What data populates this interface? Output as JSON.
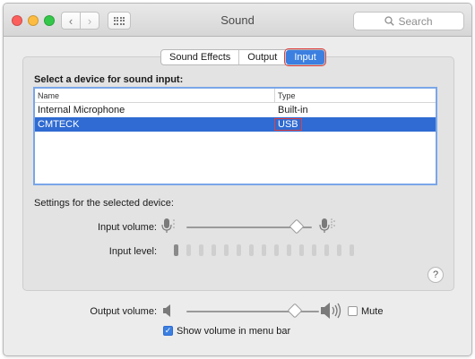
{
  "window": {
    "title": "Sound"
  },
  "toolbar": {
    "search_placeholder": "Search"
  },
  "tabs": [
    {
      "label": "Sound Effects",
      "active": false
    },
    {
      "label": "Output",
      "active": false
    },
    {
      "label": "Input",
      "active": true
    }
  ],
  "input_panel": {
    "select_title": "Select a device for sound input:",
    "table": {
      "columns": [
        "Name",
        "Type"
      ],
      "rows": [
        {
          "name": "Internal Microphone",
          "type": "Built-in",
          "selected": false
        },
        {
          "name": "CMTECK",
          "type": "USB",
          "selected": true
        }
      ]
    },
    "settings_label": "Settings for the selected device:",
    "input_volume_label": "Input volume:",
    "input_volume_level": 0.88,
    "input_level_label": "Input level:",
    "input_level_active_bars": 1,
    "input_level_total_bars": 15
  },
  "output": {
    "volume_label": "Output volume:",
    "volume_level": 0.82,
    "mute_label": "Mute",
    "mute_checked": false,
    "show_volume_label": "Show volume in menu bar",
    "show_volume_checked": true
  },
  "help": {
    "symbol": "?"
  },
  "colors": {
    "accent": "#3b7fe0",
    "selection": "#2f6bd2",
    "highlight": "#e04040"
  }
}
